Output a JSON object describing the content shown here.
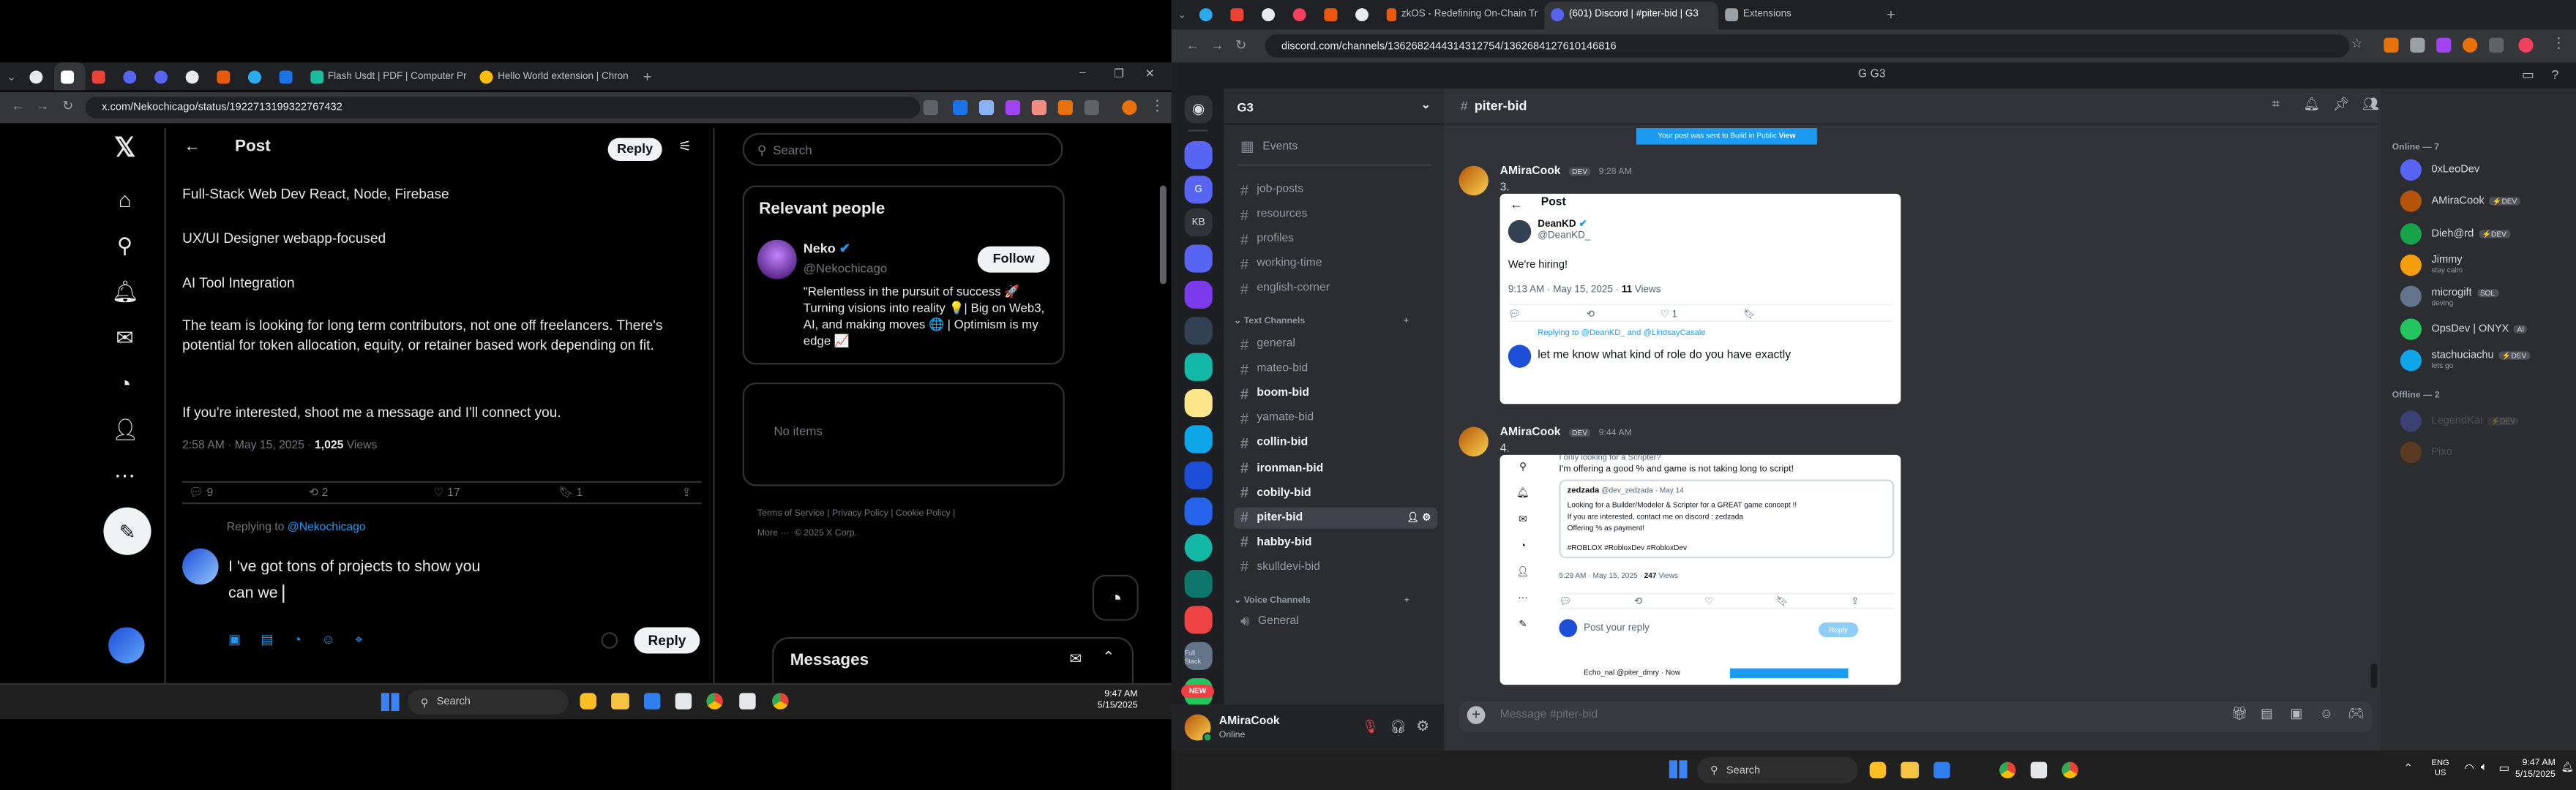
{
  "left_browser": {
    "tabs": [
      "Flash Usdt | PDF | Computer Pr",
      "Hello World extension | Chron"
    ],
    "url": "x.com/Nekochicago/status/1922713199322767432"
  },
  "x": {
    "header": {
      "title": "Post",
      "reply": "Reply"
    },
    "lines": [
      "Full-Stack Web Dev React, Node, Firebase",
      "UX/UI Designer webapp-focused",
      "AI Tool Integration",
      "The team is looking for long term contributors, not one off freelancers. There's potential for token allocation, equity, or retainer based work depending on fit.",
      "If you're interested, shoot me a message and I'll connect you."
    ],
    "meta_time": "2:58 AM · May 15, 2025 · ",
    "views_num": "1,025",
    "views_label": " Views",
    "actions": {
      "replies": "9",
      "reposts": "2",
      "likes": "17",
      "bookmarks": "1"
    },
    "replying_prefix": "Replying to ",
    "replying_handle": "@Nekochicago",
    "draft_line1": "I 've got tons of projects to show you",
    "draft_line2": "can we ",
    "reply_btn": "Reply",
    "search_placeholder": "Search",
    "relevant_title": "Relevant people",
    "person": {
      "name": "Neko",
      "handle": "@Nekochicago",
      "follow": "Follow",
      "bio": "\"Relentless in the pursuit of success 🚀 Turning visions into reality 💡| Big on Web3, AI, and making moves 🌐 | Optimism is my edge 📈"
    },
    "no_items": "No items",
    "footer": [
      "Terms of Service",
      "Privacy Policy",
      "Cookie Policy",
      "More ···",
      "© 2025 X Corp."
    ],
    "messages_title": "Messages"
  },
  "left_taskbar": {
    "search": "Search",
    "time": "9:47 AM",
    "date": "5/15/2025"
  },
  "right_browser": {
    "tabs": [
      "zkOS - Redefining On-Chain Tr",
      "(601) Discord | #piter-bid | G3",
      "Extensions"
    ],
    "url": "discord.com/channels/1362682444314312754/1362684127610146816",
    "title": "G3"
  },
  "discord": {
    "server_name": "G3",
    "events": "Events",
    "top_channels": [
      "job-posts",
      "resources",
      "profiles",
      "working-time",
      "english-corner"
    ],
    "text_cat": "Text Channels",
    "text_channels": [
      "general",
      "mateo-bid",
      "boom-bid",
      "yamate-bid",
      "collin-bid",
      "ironman-bid",
      "cobily-bid",
      "piter-bid",
      "habby-bid",
      "skulldevi-bid"
    ],
    "voice_cat": "Voice Channels",
    "voice_channels": [
      "General"
    ],
    "channel_title": "piter-bid",
    "search": "Search",
    "banner": "Your post was sent to Build in Public  ",
    "banner_link": "View",
    "msg1": {
      "num": "3.",
      "author": "AMiraCook",
      "tag": "DEV",
      "time": "9:28 AM",
      "embed": {
        "title": "Post",
        "name": "DeanKD",
        "handle": "@DeanKD_",
        "text": "We're hiring!",
        "meta": "9:13 AM · May 15, 2025 · ",
        "views": "11",
        "views_label": " Views",
        "like": "1",
        "reply_to": "Replying to @DeanKD_ and @LindsayCasale",
        "reply_text": "let me know what kind of role do you have exactly"
      }
    },
    "msg2": {
      "num": "4.",
      "author": "AMiraCook",
      "tag": "DEV",
      "time": "9:44 AM",
      "embed": {
        "l1": "I only looking for a Scripter?",
        "l2": "I'm offering a good % and game is not taking long to script!",
        "qname": "zedzada",
        "qmeta": "@dev_zedzada · May 14",
        "q1": "Looking for a Builder/Modeler & Scripter for a GREAT game concept !!",
        "q2": "If you are interested, contact me on discord : zedzada",
        "q3": "Offering % as payment!",
        "qtags": "#ROBLOX #RobloxDev #RobloxDev",
        "meta": "5:29 AM · May 15, 2025 · ",
        "views": "247",
        "views_label": " Views",
        "reply_ph": "Post your reply",
        "reply_btn": "Reply",
        "next": "Echo_nal @piter_dmry · Now"
      }
    },
    "composer": "Message #piter-bid",
    "user": {
      "name": "AMiraCook",
      "status": "Online"
    },
    "online_header": "Online — 7",
    "online": [
      {
        "name": "0xLeoDev",
        "badge": ""
      },
      {
        "name": "AMiraCook",
        "badge": "⚡DEV"
      },
      {
        "name": "Dieh@rd",
        "badge": "⚡DEV"
      },
      {
        "name": "Jimmy",
        "badge": "",
        "sub": "stay calm"
      },
      {
        "name": "microgift",
        "badge": "SOL",
        "sub": "deving"
      },
      {
        "name": "OpsDev | ONYX",
        "badge": "AI"
      },
      {
        "name": "stachuciachu",
        "badge": "⚡DEV",
        "sub": "lets go"
      }
    ],
    "offline_header": "Offline — 2",
    "offline": [
      {
        "name": "LegendKai",
        "badge": "⚡DEV"
      },
      {
        "name": "Pixo",
        "badge": ""
      }
    ],
    "new_badge": "NEW"
  },
  "right_taskbar": {
    "search": "Search",
    "lang1": "ENG",
    "lang2": "US",
    "time": "9:47 AM",
    "date": "5/15/2025"
  }
}
